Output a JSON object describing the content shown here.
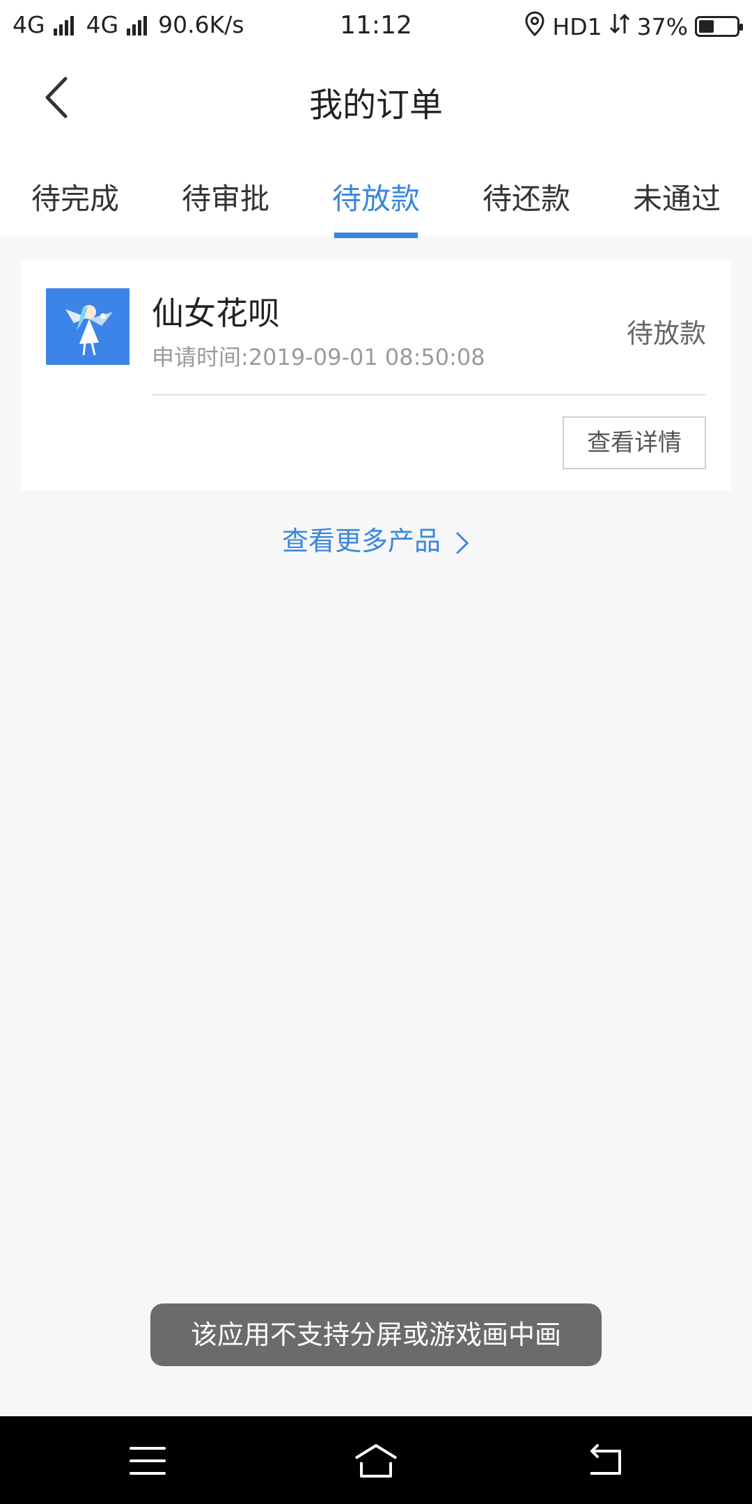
{
  "status_bar": {
    "network1": "4G",
    "network2": "4G",
    "speed": "90.6K/s",
    "time": "11:12",
    "hd": "HD1",
    "battery_pct": "37%",
    "battery_level": 0.37
  },
  "header": {
    "title": "我的订单"
  },
  "tabs": [
    {
      "label": "待完成"
    },
    {
      "label": "待审批"
    },
    {
      "label": "待放款"
    },
    {
      "label": "待还款"
    },
    {
      "label": "未通过"
    }
  ],
  "active_tab_index": 2,
  "order": {
    "product_name": "仙女花呗",
    "apply_time": "申请时间:2019-09-01 08:50:08",
    "status": "待放款",
    "detail_button": "查看详情"
  },
  "more_products": "查看更多产品",
  "toast": "该应用不支持分屏或游戏画中画",
  "colors": {
    "accent": "#3a86e0",
    "logo_bg": "#3d84e8"
  }
}
